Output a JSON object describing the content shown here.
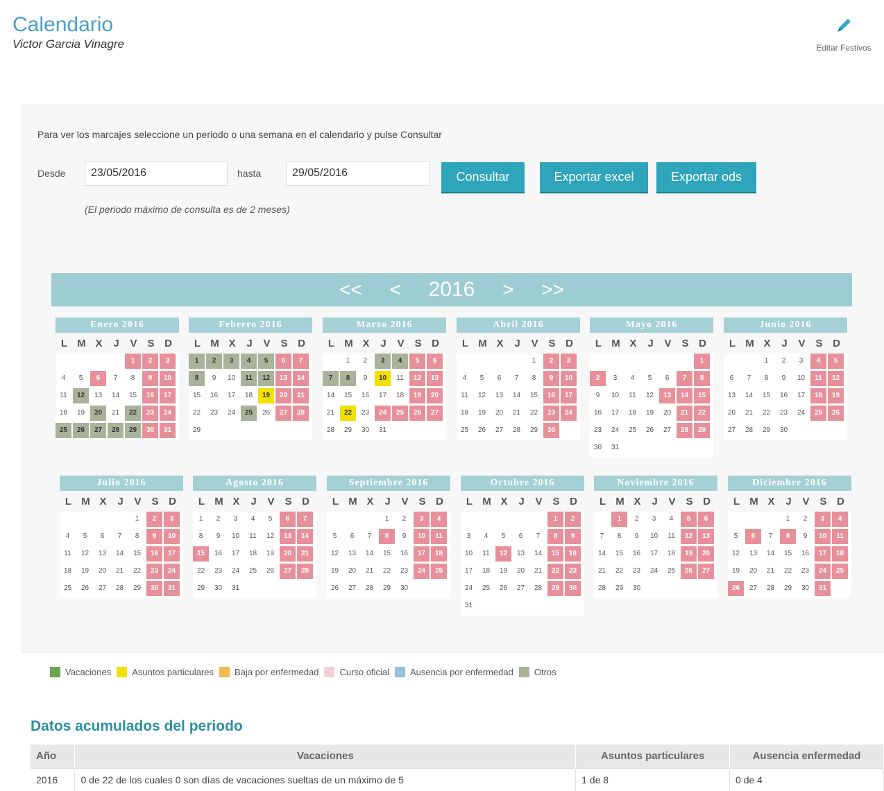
{
  "header": {
    "title": "Calendario",
    "subtitle": "Victor Garcia Vinagre",
    "edit_holidays_label": "Editar Festivos"
  },
  "query": {
    "instructions": "Para ver los marcajes seleccione un periodo o una semana en el calendario y pulse Consultar",
    "from_label": "Desde",
    "from_value": "23/05/2016",
    "to_label": "hasta",
    "to_value": "29/05/2016",
    "note": "(El periodo máximo de consulta es de 2 meses)",
    "btn_consultar": "Consultar",
    "btn_excel": "Exportar excel",
    "btn_ods": "Exportar ods"
  },
  "yearnav": {
    "prev_year": "<<",
    "prev": "<",
    "year": "2016",
    "next": ">",
    "next_year": ">>"
  },
  "weekday_headers": [
    "L",
    "M",
    "X",
    "J",
    "V",
    "S",
    "D"
  ],
  "colors": {
    "weekend": "#e8909a",
    "otros": "#a9b39a",
    "asuntos": "#f2e000",
    "accent": "#2ea5ba"
  },
  "months": [
    {
      "title": "Enero 2016",
      "offset": 4,
      "days": 31,
      "wk": [
        1,
        2,
        3,
        6,
        9,
        10,
        16,
        17,
        23,
        24,
        30,
        31
      ],
      "otros": [
        12,
        20,
        22,
        25,
        26,
        27,
        28,
        29
      ],
      "asu": []
    },
    {
      "title": "Febrero 2016",
      "offset": 0,
      "days": 29,
      "wk": [
        6,
        7,
        13,
        14,
        20,
        21,
        27,
        28
      ],
      "otros": [
        1,
        2,
        3,
        4,
        5,
        8,
        11,
        12,
        25
      ],
      "asu": [
        19
      ]
    },
    {
      "title": "Marzo 2016",
      "offset": 1,
      "days": 31,
      "wk": [
        5,
        6,
        12,
        13,
        19,
        20,
        24,
        25,
        26,
        27
      ],
      "otros": [
        3,
        4,
        7,
        8
      ],
      "asu": [
        10,
        22
      ]
    },
    {
      "title": "Abril 2016",
      "offset": 4,
      "days": 30,
      "wk": [
        2,
        3,
        9,
        10,
        16,
        17,
        23,
        24,
        30
      ],
      "otros": [],
      "asu": []
    },
    {
      "title": "Mayo 2016",
      "offset": 6,
      "days": 31,
      "wk": [
        1,
        2,
        7,
        8,
        13,
        14,
        15,
        21,
        22,
        28,
        29
      ],
      "otros": [],
      "asu": []
    },
    {
      "title": "Junio 2016",
      "offset": 2,
      "days": 30,
      "wk": [
        4,
        5,
        11,
        12,
        18,
        19,
        25,
        26
      ],
      "otros": [],
      "asu": []
    },
    {
      "title": "Julio 2016",
      "offset": 4,
      "days": 31,
      "wk": [
        2,
        3,
        9,
        10,
        16,
        17,
        23,
        24,
        30,
        31
      ],
      "otros": [],
      "asu": []
    },
    {
      "title": "Agosto 2016",
      "offset": 0,
      "days": 31,
      "wk": [
        6,
        7,
        13,
        14,
        15,
        20,
        21,
        27,
        28
      ],
      "otros": [],
      "asu": []
    },
    {
      "title": "Septiembre 2016",
      "offset": 3,
      "days": 30,
      "wk": [
        3,
        4,
        8,
        10,
        11,
        17,
        18,
        24,
        25
      ],
      "otros": [],
      "asu": []
    },
    {
      "title": "Octubre 2016",
      "offset": 5,
      "days": 31,
      "wk": [
        1,
        2,
        8,
        9,
        12,
        15,
        16,
        22,
        23,
        29,
        30
      ],
      "otros": [],
      "asu": []
    },
    {
      "title": "Noviembre 2016",
      "offset": 1,
      "days": 30,
      "wk": [
        1,
        5,
        6,
        12,
        13,
        19,
        20,
        26,
        27
      ],
      "otros": [],
      "asu": []
    },
    {
      "title": "Diciembre 2016",
      "offset": 3,
      "days": 31,
      "wk": [
        3,
        4,
        6,
        8,
        10,
        11,
        17,
        18,
        24,
        25,
        26,
        31
      ],
      "otros": [],
      "asu": []
    }
  ],
  "legend": [
    {
      "label": "Vacaciones",
      "color": "#6aa84f"
    },
    {
      "label": "Asuntos particulares",
      "color": "#f2e000"
    },
    {
      "label": "Baja por enfermedad",
      "color": "#f6b94a"
    },
    {
      "label": "Curso oficial",
      "color": "#f5cfd8"
    },
    {
      "label": "Ausencia por enfermedad",
      "color": "#8fc3e0"
    },
    {
      "label": "Otros",
      "color": "#a9b39a"
    }
  ],
  "summary": {
    "title": "Datos acumulados del periodo",
    "headers": [
      "Año",
      "Vacaciones",
      "Asuntos particulares",
      "Ausencia enfermedad"
    ],
    "rows": [
      [
        "2016",
        "0 de 22 de los cuales 0 son días de vacaciones sueltas de un máximo de 5",
        "1 de 8",
        "0 de 4"
      ]
    ]
  }
}
